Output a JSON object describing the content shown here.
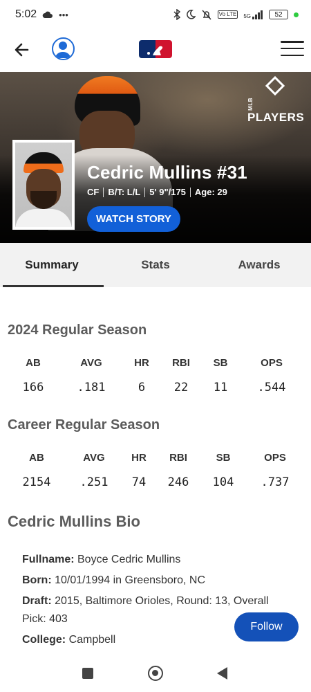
{
  "status_bar": {
    "time": "5:02",
    "left_icons": [
      "cloud-icon",
      "more-dots-icon"
    ],
    "right_icons": [
      "bluetooth-icon",
      "moon-icon",
      "mute-icon",
      "volte-icon",
      "5g-signal-icon"
    ],
    "volte_label": "Vo LTE",
    "network_label": "5G",
    "battery": "52"
  },
  "header": {
    "icons": [
      "back-arrow-icon",
      "profile-icon",
      "mlb-logo",
      "hamburger-menu-icon"
    ]
  },
  "hero": {
    "logo_text": "PLAYERS",
    "logo_prefix": "MLB",
    "player_name": "Cedric Mullins #31",
    "position": "CF",
    "bats_throws": "B/T: L/L",
    "height_weight": "5' 9\"/175",
    "age": "Age: 29",
    "watch_label": "WATCH STORY"
  },
  "tabs": [
    {
      "label": "Summary",
      "active": true
    },
    {
      "label": "Stats",
      "active": false
    },
    {
      "label": "Awards",
      "active": false
    }
  ],
  "season_stats": {
    "title": "2024 Regular Season",
    "headers": [
      "AB",
      "AVG",
      "HR",
      "RBI",
      "SB",
      "OPS"
    ],
    "values": [
      "166",
      ".181",
      "6",
      "22",
      "11",
      ".544"
    ]
  },
  "career_stats": {
    "title": "Career Regular Season",
    "headers": [
      "AB",
      "AVG",
      "HR",
      "RBI",
      "SB",
      "OPS"
    ],
    "values": [
      "2154",
      ".251",
      "74",
      "246",
      "104",
      ".737"
    ]
  },
  "bio": {
    "title": "Cedric Mullins Bio",
    "lines": [
      {
        "key": "Fullname:",
        "value": " Boyce Cedric Mullins"
      },
      {
        "key": "Born:",
        "value": " 10/01/1994 in Greensboro, NC"
      },
      {
        "key": "Draft:",
        "value": " 2015, Baltimore Orioles, Round: 13, Overall Pick: 403"
      },
      {
        "key": "College:",
        "value": " Campbell"
      }
    ]
  },
  "follow_label": "Follow",
  "nav": {
    "icons": [
      "recents-square-icon",
      "home-circle-icon",
      "back-triangle-icon"
    ]
  },
  "colors": {
    "accent_blue": "#1260d8",
    "follow_blue": "#1451b8",
    "orioles_orange": "#ee6c1a"
  }
}
